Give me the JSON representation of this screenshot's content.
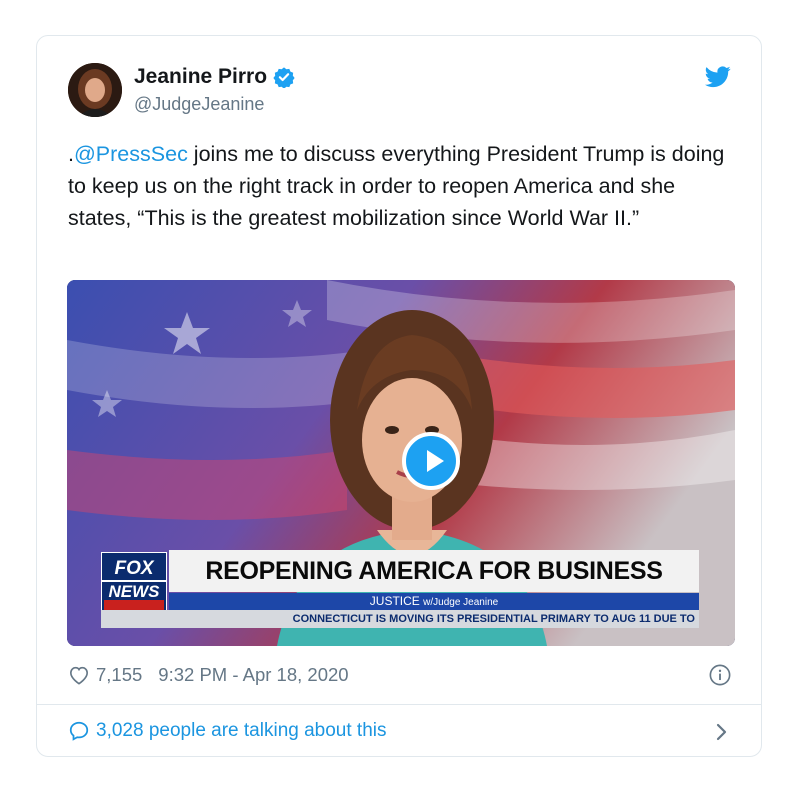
{
  "tweet": {
    "author_name": "Jeanine Pirro",
    "author_handle": "@JudgeJeanine",
    "text_prefix": ".",
    "mention": "@PressSec",
    "text_body": " joins me to discuss everything President Trump is doing to keep us on the right track in order to reopen America and she states, “This is the greatest mobilization since World War II.”",
    "likes": "7,155",
    "timestamp": "9:32 PM - Apr 18, 2020",
    "talking": "3,028 people are talking about this"
  },
  "video": {
    "logo_line1": "FOX",
    "logo_line2": "NEWS",
    "headline": "REOPENING AMERICA FOR BUSINESS",
    "show_name": "JUSTICE",
    "show_host": "w/Judge Jeanine",
    "ticker": "CONNECTICUT IS MOVING ITS PRESIDENTIAL PRIMARY TO AUG 11 DUE TO"
  },
  "colors": {
    "accent": "#1da1f2",
    "link": "#1b95e0",
    "muted": "#657786",
    "border": "#e1e8ed"
  },
  "icons": [
    "verified-icon",
    "twitter-bird-icon",
    "play-icon",
    "heart-icon",
    "info-icon",
    "comment-icon",
    "chevron-right-icon"
  ]
}
